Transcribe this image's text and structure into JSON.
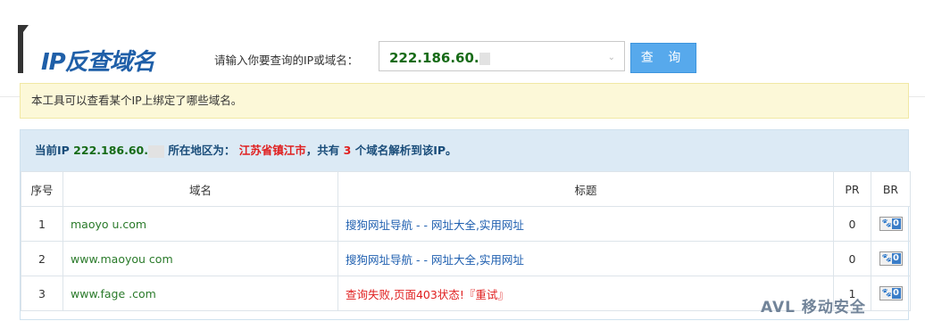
{
  "brand": {
    "title": "IP反查域名"
  },
  "search": {
    "prompt": "请输入你要查询的IP或域名：",
    "value": "222.186.60.",
    "button": "查 询"
  },
  "notice": "本工具可以查看某个IP上绑定了哪些域名。",
  "result": {
    "prefix": "当前IP",
    "ip": "222.186.60.",
    "region_label": "所在地区为：",
    "region": "江苏省镇江市",
    "count_prefix": "，共有",
    "count": "3",
    "count_suffix": "个域名解析到该IP。"
  },
  "table": {
    "headers": [
      "序号",
      "域名",
      "标题",
      "PR",
      "BR"
    ],
    "rows": [
      {
        "num": "1",
        "domain": "maoyo  u.com",
        "title": "搜狗网址导航 - - 网址大全,实用网址",
        "pr": "0",
        "br": "0",
        "fail": false
      },
      {
        "num": "2",
        "domain": "www.maoyou  com",
        "title": "搜狗网址导航 - - 网址大全,实用网址",
        "pr": "0",
        "br": "0",
        "fail": false
      },
      {
        "num": "3",
        "domain": "www.fage  .com",
        "title": "查询失败,页面403状态!『重试』",
        "pr": "1",
        "br": "0",
        "fail": true
      }
    ]
  },
  "watermark": "移动安全"
}
